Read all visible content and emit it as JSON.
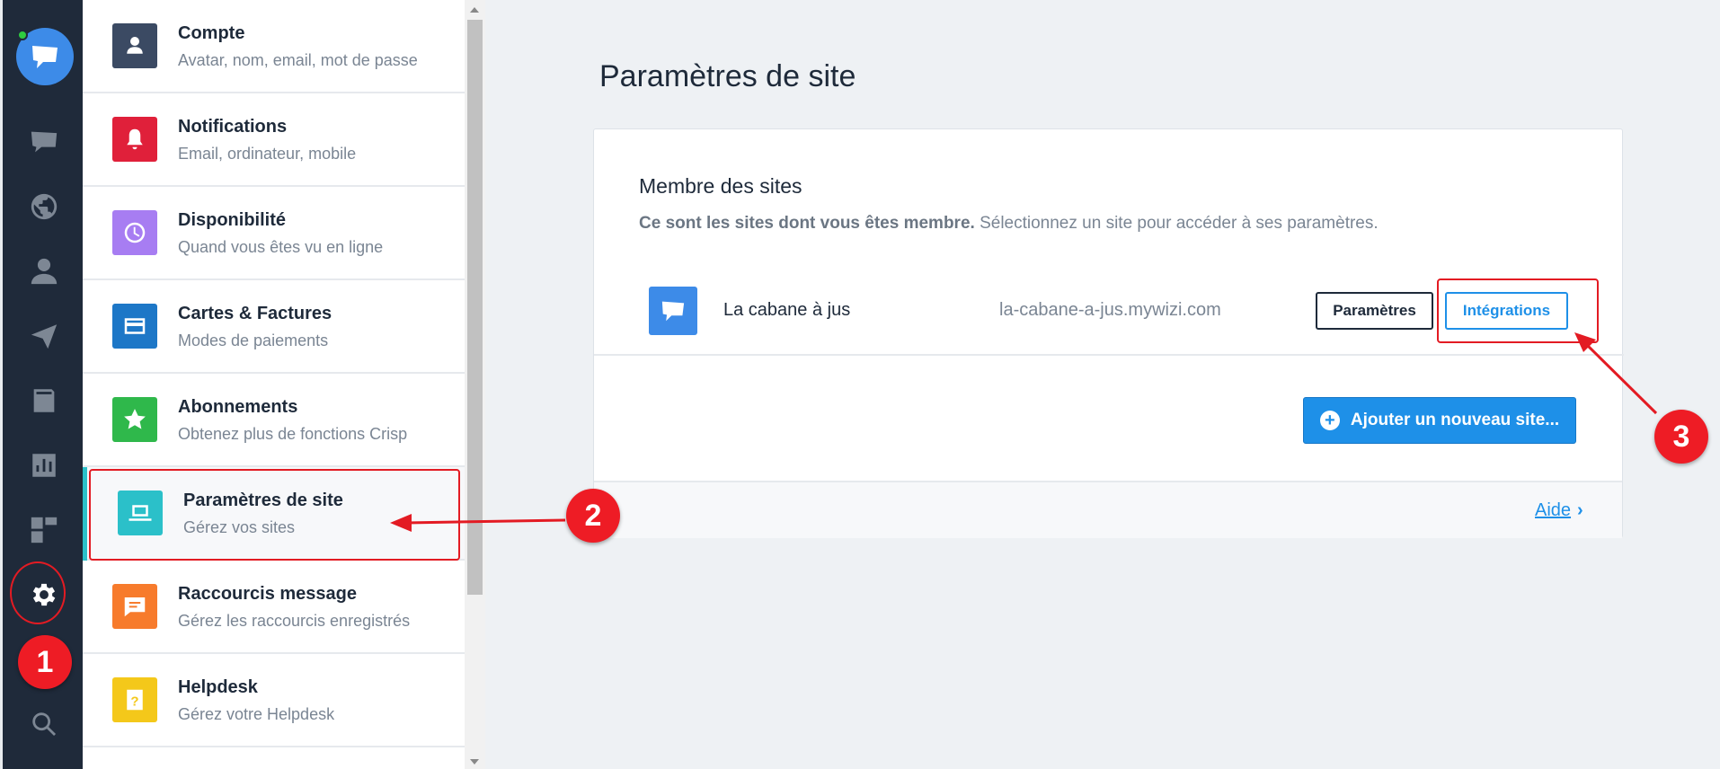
{
  "rail": {
    "icons": [
      "chat-icon",
      "globe-icon",
      "person-icon",
      "send-icon",
      "book-icon",
      "chart-icon",
      "plugins-icon",
      "gear-icon",
      "search-icon"
    ]
  },
  "menu": {
    "items": [
      {
        "title": "Compte",
        "sub": "Avatar, nom, email, mot de passe",
        "color": "#3b4a63",
        "icon": "user-icon"
      },
      {
        "title": "Notifications",
        "sub": "Email, ordinateur, mobile",
        "color": "#e0203a",
        "icon": "bell-icon"
      },
      {
        "title": "Disponibilité",
        "sub": "Quand vous êtes vu en ligne",
        "color": "#a77df2",
        "icon": "clock-icon"
      },
      {
        "title": "Cartes & Factures",
        "sub": "Modes de paiements",
        "color": "#1d77c7",
        "icon": "card-icon"
      },
      {
        "title": "Abonnements",
        "sub": "Obtenez plus de fonctions Crisp",
        "color": "#2fb84b",
        "icon": "star-icon"
      },
      {
        "title": "Paramètres de site",
        "sub": "Gérez vos sites",
        "color": "#2bc0c9",
        "icon": "laptop-icon"
      },
      {
        "title": "Raccourcis message",
        "sub": "Gérez les raccourcis enregistrés",
        "color": "#f77b2c",
        "icon": "message-icon"
      },
      {
        "title": "Helpdesk",
        "sub": "Gérez votre Helpdesk",
        "color": "#f4c81a",
        "icon": "helpdesk-icon"
      }
    ]
  },
  "main": {
    "title": "Paramètres de site",
    "card": {
      "title": "Membre des sites",
      "desc_bold": "Ce sont les sites dont vous êtes membre.",
      "desc_rest": "Sélectionnez un site pour accéder à ses paramètres.",
      "site": {
        "name": "La cabane à jus",
        "domain": "la-cabane-a-jus.mywizi.com",
        "settings_label": "Paramètres",
        "integrations_label": "Intégrations"
      },
      "add_label": "Ajouter un nouveau site...",
      "help_label": "Aide"
    }
  },
  "annotations": {
    "badges": [
      "1",
      "2",
      "3"
    ],
    "color": "#e31b23"
  }
}
